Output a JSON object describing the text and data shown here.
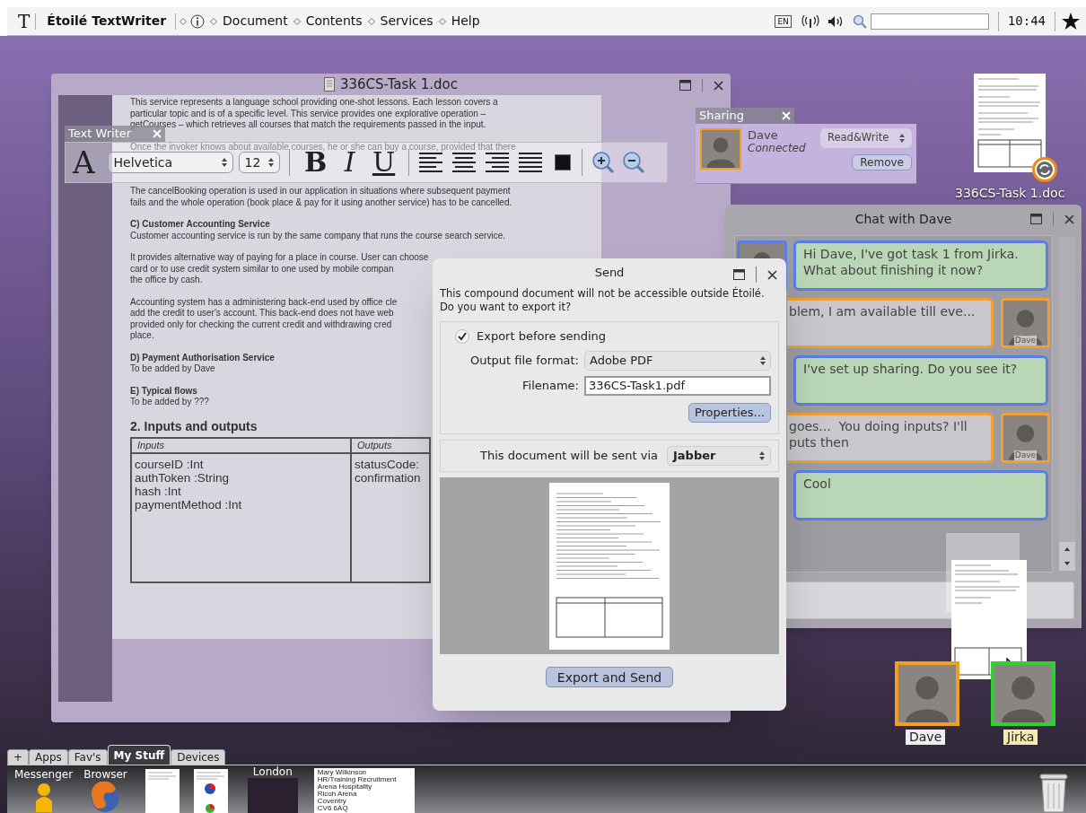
{
  "menubar": {
    "app_logo": "T",
    "app_name": "Étoilé TextWriter",
    "menus": [
      "Document",
      "Contents",
      "Services",
      "Help"
    ],
    "keyboard_layout": "EN",
    "clock": "10:44"
  },
  "document_window": {
    "title": "336CS-Task 1.doc",
    "blocks": [
      {
        "kind": "text",
        "lines": [
          "This service represents a language school providing one-shot lessons. Each lesson covers a",
          "particular topic and is of a specific level. This service provides one explorative operation –",
          "getCourses – which retrieves all courses that match the requirements passed in the input."
        ]
      },
      {
        "kind": "text",
        "lines": [
          "Once the invoker knows about available courses, he or she can buy a course, provided that there"
        ]
      },
      {
        "kind": "text",
        "lines": [
          "The cancelBooking operation is used in our application in situations where subsequent payment",
          "fails and the whole operation (book place & pay for it using another service) has to be cancelled."
        ]
      },
      {
        "kind": "subheading",
        "text": "C) Customer Accounting Service",
        "lines": [
          "Customer accounting service is run by the same company that runs the course search service."
        ]
      },
      {
        "kind": "text",
        "lines": [
          "It provides alternative way of paying for a place in course. User can choose",
          "card or to use credit system similar to one used by mobile compan",
          "the office by cash."
        ]
      },
      {
        "kind": "text",
        "lines": [
          "Accounting system has a administering back-end used by office cle",
          "add the credit to user's account. This back-end does not have web",
          "provided only for checking the current credit and withdrawing cred",
          "place."
        ]
      },
      {
        "kind": "subheading",
        "text": "D) Payment Authorisation Service",
        "lines": [
          "To be added by Dave"
        ]
      },
      {
        "kind": "subheading",
        "text": "E) Typical flows",
        "lines": [
          "To be added by ???"
        ]
      },
      {
        "kind": "heading",
        "text": "2. Inputs and outputs"
      },
      {
        "kind": "table",
        "columns": [
          "Inputs",
          "Outputs"
        ],
        "cells": [
          [
            "courseID :Int",
            "authToken :String",
            "hash :Int",
            "paymentMethod :Int"
          ],
          [
            "statusCode:",
            "confirmation"
          ]
        ]
      }
    ]
  },
  "text_writer_panel": {
    "title": "Text Writer",
    "font_glyph": "A",
    "font": "Helvetica",
    "size": "12",
    "styles": [
      {
        "kind": "bold",
        "label": "B"
      },
      {
        "kind": "italic",
        "label": "I"
      },
      {
        "kind": "underline",
        "label": "U"
      }
    ]
  },
  "sharing_panel": {
    "title": "Sharing",
    "user": "Dave",
    "status": "Connected",
    "permission": "Read&Write",
    "remove_button": "Remove"
  },
  "desktop_file": {
    "label": "336CS-Task 1.doc"
  },
  "chat_window": {
    "title": "Chat with Dave",
    "messages": [
      {
        "kind": "sent",
        "text": "Hi Dave, I've got task 1 from Jirka. What about finishing it now?",
        "avatar_visible": true
      },
      {
        "kind": "received",
        "text": "blem, I am available till eve...",
        "sender": "Dave"
      },
      {
        "kind": "sent",
        "text": "I've set up sharing. Do you see it?",
        "avatar_visible": false
      },
      {
        "kind": "received",
        "text": "goes...  You doing inputs? I'll\nputs then",
        "sender": "Dave"
      },
      {
        "kind": "sent",
        "text": "Cool",
        "avatar_visible": false
      }
    ]
  },
  "send_dialog": {
    "title": "Send",
    "message": "This compound document will not be accessible outside Étoilé. Do you want to export it?",
    "export": {
      "label": "Export before sending",
      "checked": true
    },
    "format_label": "Output file format:",
    "format": "Adobe PDF",
    "filename_label": "Filename:",
    "filename": "336CS-Task1.pdf",
    "properties_button": "Properties...",
    "via_label": "This document will be sent via",
    "via": "Jabber",
    "send_button": "Export and Send"
  },
  "contacts": [
    {
      "name": "Dave",
      "color": "#f0a020"
    },
    {
      "name": "Jirka",
      "color": "#30d030"
    }
  ],
  "dock": {
    "tabs": [
      {
        "label": "+",
        "selected": false
      },
      {
        "label": "Apps",
        "selected": false
      },
      {
        "label": "Fav's",
        "selected": false
      },
      {
        "label": "My Stuff",
        "selected": true
      },
      {
        "label": "Devices",
        "selected": false
      }
    ],
    "items": [
      {
        "kind": "messenger",
        "label": "Messenger"
      },
      {
        "kind": "browser",
        "label": "Browser"
      },
      {
        "kind": "document"
      },
      {
        "kind": "report"
      },
      {
        "kind": "photo",
        "label": "London"
      },
      {
        "kind": "contact",
        "lines": [
          "Mary Wilkinson",
          "HR/Training Recruitment",
          "Arena Hospitality",
          "Ricoh Arena",
          "Coventry",
          "CV6 6AQ"
        ]
      }
    ]
  }
}
